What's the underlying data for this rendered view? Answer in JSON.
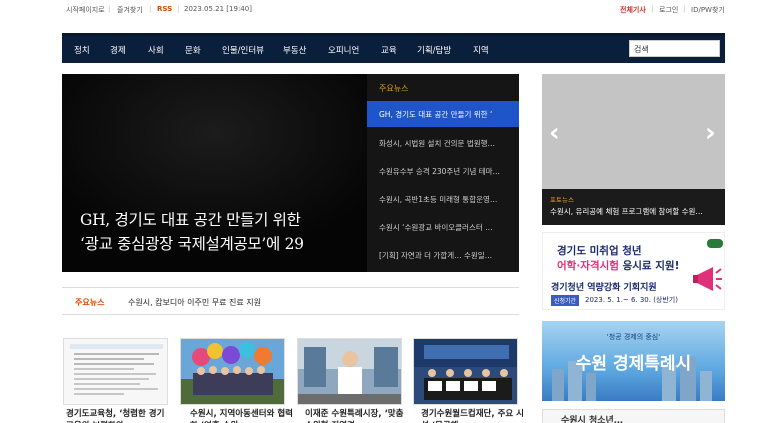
{
  "topbar": {
    "home": "시작페이지로",
    "favorite": "즐겨찾기",
    "rss": "RSS",
    "datetime": "2023.05.21 [19:40]",
    "all_articles": "전체기사",
    "login": "로그인",
    "idpw": "ID/PW찾기"
  },
  "nav": {
    "items": [
      "정치",
      "경제",
      "사회",
      "문화",
      "인물/인터뷰",
      "부동산",
      "오피니언",
      "교육",
      "기획/탐방",
      "지역"
    ],
    "search_placeholder": "검색"
  },
  "hero": {
    "title_line1": "GH, 경기도 대표 공간 만들기 위한",
    "title_line2": "‘광교 중심광장 국제설계공모’에 29",
    "list_header": "주요뉴스",
    "list": [
      "GH, 경기도 대표 공간 만들기 위한 ‘",
      "화성시, 시법원 설치 건의문 법원행…",
      "수원유수부 승격 230주년 기념 테마…",
      "수원시, 곡반1초등 미래형 통합운영…",
      "수원시 ‘수원광교 바이오클러스터 …",
      "[기획] 자연과 더 가깝게… 수원일…"
    ]
  },
  "ticker": {
    "label": "주요뉴스",
    "text": "수원시, 캄보디아 이주민 무료 진료 지원"
  },
  "thumbs": [
    {
      "caption": "경기도교육청, ‘청렴한 경기교육의 보편화와"
    },
    {
      "caption": "수원시, 지역아동센터와 협력한 ‘연휴 수원…"
    },
    {
      "caption": "이재준 수원특례시장, ‘맞춤 수원형 지역경…"
    },
    {
      "caption": "경기수원월드컵재단, 주요 시설 ‘무공해…"
    }
  ],
  "photo_news": {
    "label": "포토뉴스",
    "caption": "수원시, 유리공예 체험 프로그램에 참여할 수원…"
  },
  "ad1": {
    "title": "경기도 미취업 청년",
    "subtitle_a": "어학·자격시험",
    "subtitle_b": " 응시료 지원!",
    "program": "경기청년 역량강화 기회지원",
    "period_label": "신청기간",
    "period": "2023. 5. 1.~ 6. 30. (상반기)"
  },
  "ad2": {
    "top": "'청공 경제의 중심'",
    "main": "수원 경제특례시"
  },
  "ad3": {
    "text": "수원시 청소년…"
  },
  "colors": {
    "nav_bg": "#0a1f3c",
    "accent_orange": "#d94a00",
    "active_blue": "#1e55c8",
    "all_articles_red": "#d1302c"
  }
}
